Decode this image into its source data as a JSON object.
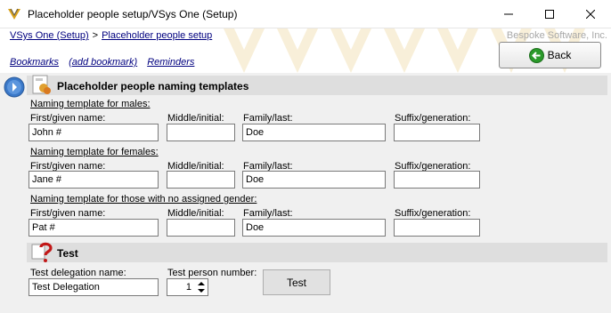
{
  "window": {
    "title": "Placeholder people setup/VSys One (Setup)"
  },
  "header": {
    "breadcrumb": [
      "VSys One (Setup)",
      "Placeholder people setup"
    ],
    "breadcrumb_sep": ">",
    "company": "Bespoke Software, Inc.",
    "bookmarks": [
      "Bookmarks",
      "(add bookmark)",
      "Reminders"
    ],
    "back_label": "Back"
  },
  "naming": {
    "title": "Placeholder people naming templates",
    "columns": {
      "first": "First/given name:",
      "middle": "Middle/initial:",
      "family": "Family/last:",
      "suffix": "Suffix/generation:"
    },
    "groups": [
      {
        "heading": "Naming template for males:",
        "first": "John #",
        "middle": "",
        "family": "Doe",
        "suffix": ""
      },
      {
        "heading": "Naming template for females:",
        "first": "Jane #",
        "middle": "",
        "family": "Doe",
        "suffix": ""
      },
      {
        "heading": "Naming template for those with no assigned gender:",
        "first": "Pat #",
        "middle": "",
        "family": "Doe",
        "suffix": ""
      }
    ]
  },
  "test": {
    "title": "Test",
    "delegation_label": "Test delegation name:",
    "delegation_value": "Test Delegation",
    "person_number_label": "Test person number:",
    "person_number_value": "1",
    "button_label": "Test"
  },
  "colors": {
    "link": "#00007f",
    "section_band": "#dedede",
    "back_icon": "#2a9a2a",
    "nav_circle": "#3a78c8"
  }
}
